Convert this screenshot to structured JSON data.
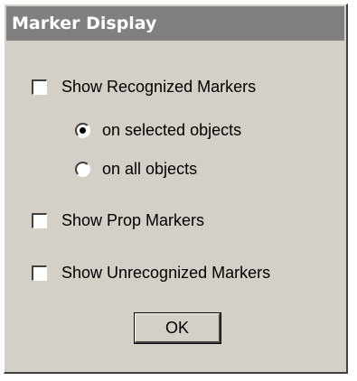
{
  "dialog": {
    "title": "Marker Display",
    "options": {
      "show_recognized": {
        "label": "Show Recognized Markers",
        "checked": false
      },
      "on_selected": {
        "label": "on selected objects",
        "selected": true
      },
      "on_all": {
        "label": "on all objects",
        "selected": false
      },
      "show_prop": {
        "label": "Show Prop Markers",
        "checked": false
      },
      "show_unrecognized": {
        "label": "Show Unrecognized Markers",
        "checked": false
      }
    },
    "ok_label": "OK"
  }
}
